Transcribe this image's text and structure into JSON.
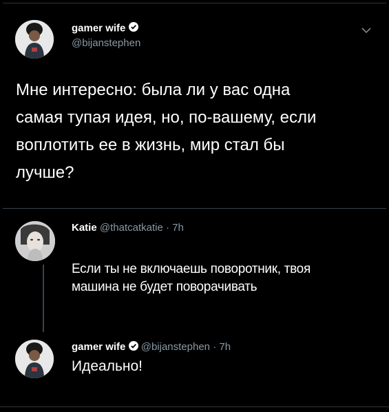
{
  "main_tweet": {
    "name": "gamer wife",
    "handle": "@bijanstephen",
    "text_lines": [
      "Мне интересно: была ли у вас одна",
      "самая тупая идея, но, по-вашему, если",
      "воплотить ее в жизнь, мир стал бы",
      "лучше?"
    ]
  },
  "reply_1": {
    "name": "Katie",
    "handle": "@thatcatkatie",
    "time": "· 7h",
    "text_lines": [
      "Если ты не включаешь поворотник, твоя",
      "машина не будет поворачивать"
    ]
  },
  "reply_2": {
    "name": "gamer wife",
    "handle": "@bijanstephen",
    "time": "· 7h",
    "text": "Идеально!"
  },
  "colors": {
    "background": "#000000",
    "text": "#ffffff",
    "muted": "#8899a6",
    "divider": "#38444d"
  },
  "icons": [
    "verified-badge-icon",
    "chevron-down-icon"
  ]
}
